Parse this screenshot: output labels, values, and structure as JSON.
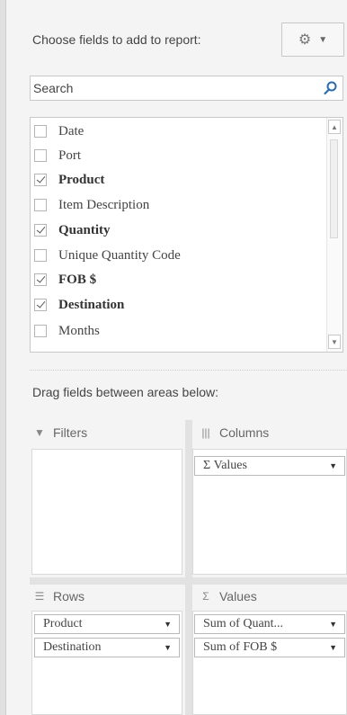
{
  "header": {
    "label": "Choose fields to add to report:"
  },
  "tools": {
    "icon": "gear-icon",
    "dropdown_icon": "chevron-down-icon"
  },
  "search": {
    "placeholder": "Search",
    "value": "",
    "icon": "search-icon"
  },
  "fields": [
    {
      "label": "Date",
      "checked": false
    },
    {
      "label": "Port",
      "checked": false
    },
    {
      "label": "Product",
      "checked": true
    },
    {
      "label": "Item Description",
      "checked": false
    },
    {
      "label": "Quantity",
      "checked": true
    },
    {
      "label": "Unique Quantity Code",
      "checked": false
    },
    {
      "label": "FOB $",
      "checked": true
    },
    {
      "label": "Destination",
      "checked": true
    },
    {
      "label": "Months",
      "checked": false
    }
  ],
  "drag_hint": "Drag fields between areas below:",
  "areas": {
    "filters": {
      "title": "Filters",
      "icon": "filter-icon",
      "items": []
    },
    "columns": {
      "title": "Columns",
      "icon": "columns-icon",
      "items": [
        "Σ Values"
      ]
    },
    "rows": {
      "title": "Rows",
      "icon": "rows-icon",
      "items": [
        "Product",
        "Destination"
      ]
    },
    "values": {
      "title": "Values",
      "icon": "sigma-icon",
      "items": [
        "Sum of Quant...",
        "Sum of FOB $"
      ]
    }
  }
}
